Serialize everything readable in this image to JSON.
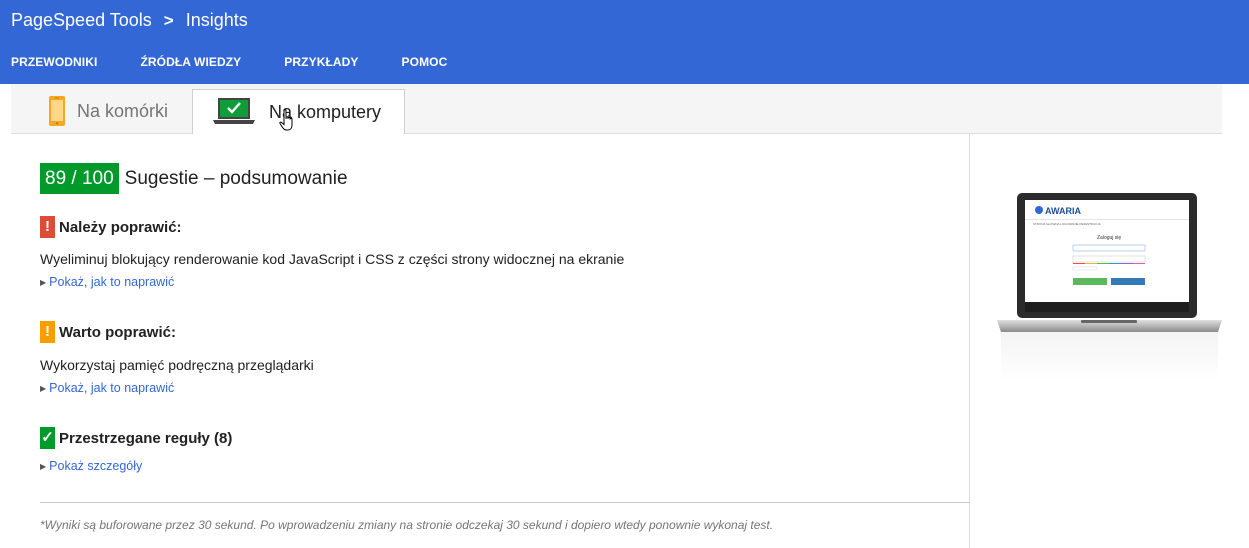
{
  "header": {
    "product": "PageSpeed Tools",
    "separator": ">",
    "page": "Insights",
    "nav": [
      "PRZEWODNIKI",
      "ŹRÓDŁA WIEDZY",
      "PRZYKŁADY",
      "POMOC"
    ]
  },
  "tabs": {
    "mobile": "Na komórki",
    "desktop": "Na komputery"
  },
  "summary": {
    "score": "89 / 100",
    "title": "Sugestie – podsumowanie"
  },
  "sections": {
    "must_fix": {
      "badge": "!",
      "title": "Należy poprawić:",
      "description": "Wyeliminuj blokujący renderowanie kod JavaScript i CSS z części strony widocznej na ekranie",
      "link": "Pokaż, jak to naprawić"
    },
    "should_fix": {
      "badge": "!",
      "title": "Warto poprawić:",
      "description": "Wykorzystaj pamięć podręczną przeglądarki",
      "link": "Pokaż, jak to naprawić"
    },
    "passed": {
      "badge": "✓",
      "title": "Przestrzegane reguły (8)",
      "link": "Pokaż szczegóły"
    }
  },
  "footnote": "*Wyniki są buforowane przez 30 sekund. Po wprowadzeniu zmiany na stronie odczekaj 30 sekund i dopiero wtedy ponownie wykonaj test.",
  "preview": {
    "site_name": "AWARIA",
    "menu": "STRONA GŁÓWNA  LOGOWANIE  REJESTRACJA",
    "heading": "Zaloguj się"
  },
  "colors": {
    "header": "#3367d6",
    "score_good": "#009a2b",
    "error": "#dd4b39",
    "warning": "#fa9d00",
    "link": "#3367d6"
  }
}
